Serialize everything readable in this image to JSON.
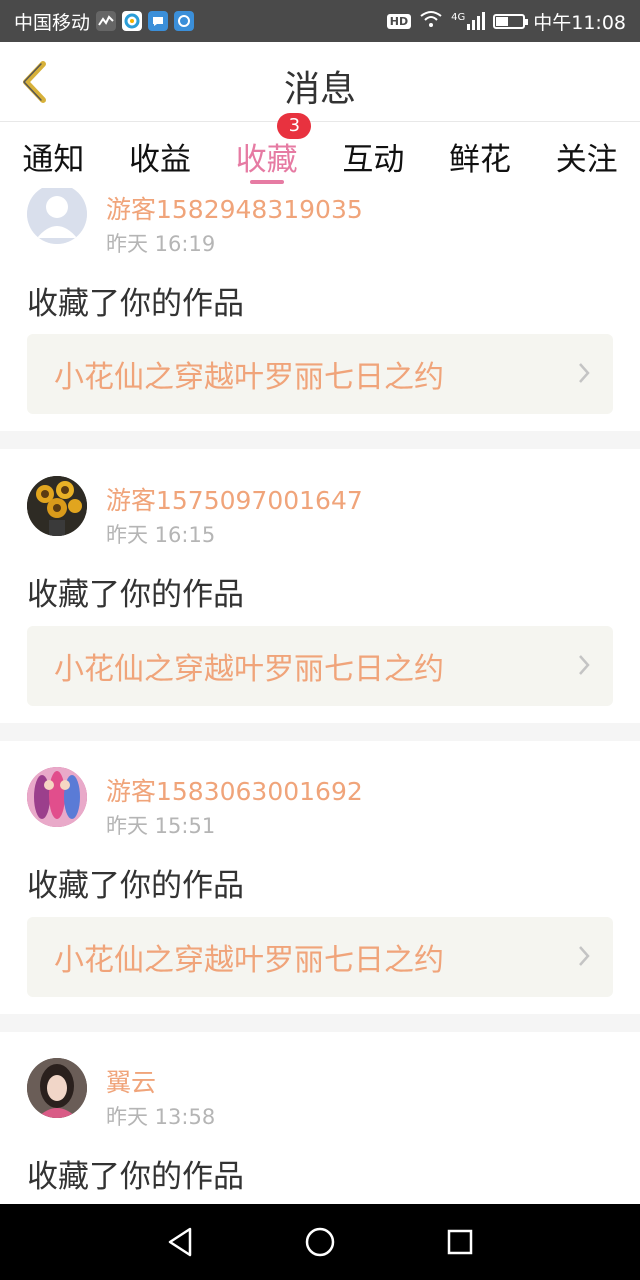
{
  "status_bar": {
    "carrier": "中国移动",
    "hd": "HD",
    "network": "4G",
    "battery_level": 0.45,
    "time": "中午11:08"
  },
  "header": {
    "title": "消息",
    "back_icon": "chevron-left-icon"
  },
  "tabs": [
    {
      "label": "通知",
      "active": false
    },
    {
      "label": "收益",
      "active": false
    },
    {
      "label": "收藏",
      "active": true,
      "badge": "3"
    },
    {
      "label": "互动",
      "active": false
    },
    {
      "label": "鲜花",
      "active": false
    },
    {
      "label": "关注",
      "active": false
    }
  ],
  "colors": {
    "accent": "#e67ba3",
    "username": "#f0a47a",
    "badge": "#e8323f"
  },
  "messages": [
    {
      "username": "游客1582948319035",
      "time": "昨天 16:19",
      "action": "收藏了你的作品",
      "work_title": "小花仙之穿越叶罗丽七日之约",
      "avatar": "default-avatar"
    },
    {
      "username": "游客1575097001647",
      "time": "昨天 16:15",
      "action": "收藏了你的作品",
      "work_title": "小花仙之穿越叶罗丽七日之约",
      "avatar": "sunflower-avatar"
    },
    {
      "username": "游客1583063001692",
      "time": "昨天 15:51",
      "action": "收藏了你的作品",
      "work_title": "小花仙之穿越叶罗丽七日之约",
      "avatar": "anime-avatar"
    },
    {
      "username": "翼云",
      "time": "昨天 13:58",
      "action": "收藏了你的作品",
      "work_title": "",
      "avatar": "portrait-avatar"
    }
  ],
  "nav": {
    "back": "back-triangle-icon",
    "home": "home-circle-icon",
    "recent": "recent-square-icon"
  }
}
